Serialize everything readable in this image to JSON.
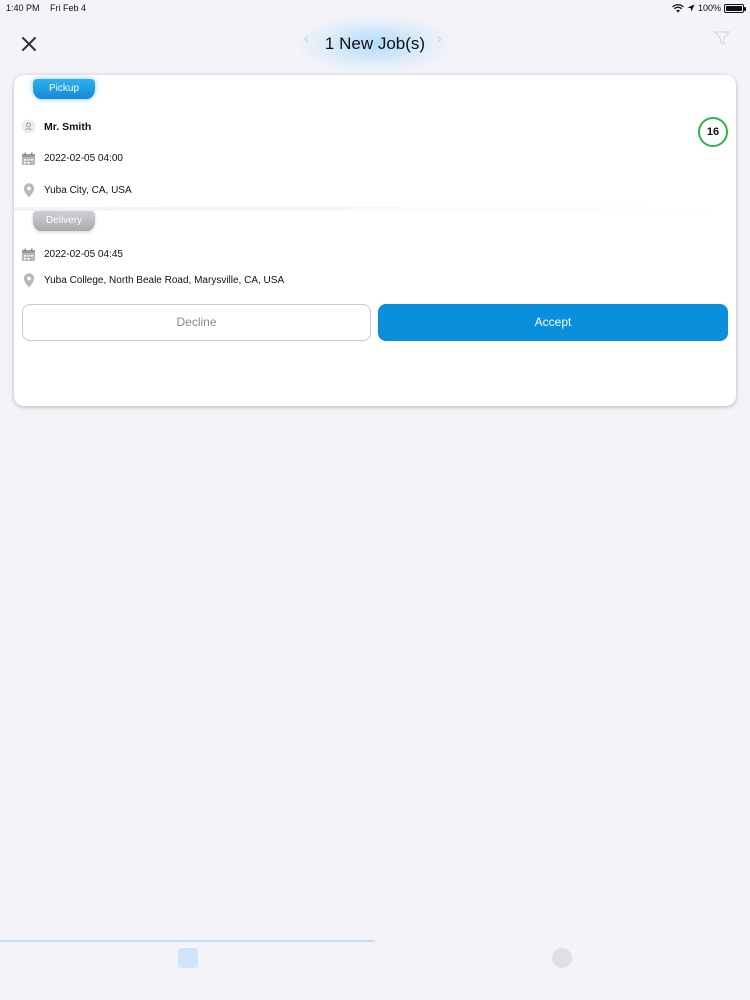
{
  "status_bar": {
    "time": "1:40 PM",
    "date": "Fri Feb 4",
    "battery": "100%"
  },
  "header": {
    "title": "1 New Job(s)"
  },
  "job": {
    "pickup_tag": "Pickup",
    "delivery_tag": "Delivery",
    "customer": "Mr. Smith",
    "pickup_datetime": "2022-02-05 04:00",
    "pickup_location": "Yuba City, CA, USA",
    "delivery_datetime": "2022-02-05 04:45",
    "delivery_location": "Yuba College, North Beale Road, Marysville, CA, USA",
    "count": "16"
  },
  "actions": {
    "decline": "Decline",
    "accept": "Accept"
  },
  "colors": {
    "accent": "#0a8fdc",
    "badge": "#35b44a"
  }
}
